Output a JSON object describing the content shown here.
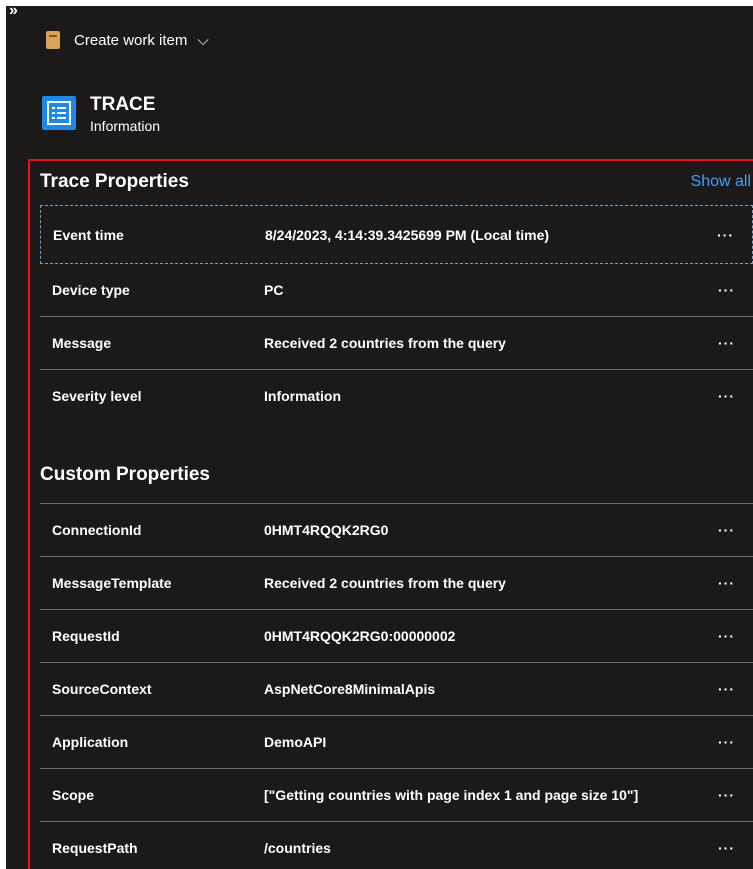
{
  "toolbar": {
    "create_label": "Create work item",
    "chevron": "⌵"
  },
  "header": {
    "title": "TRACE",
    "subtitle": "Information"
  },
  "trace": {
    "title": "Trace Properties",
    "show_all": "Show all",
    "rows": [
      {
        "name": "Event time",
        "value": "8/24/2023, 4:14:39.3425699 PM (Local time)"
      },
      {
        "name": "Device type",
        "value": "PC"
      },
      {
        "name": "Message",
        "value": "Received 2 countries from the query"
      },
      {
        "name": "Severity level",
        "value": "Information"
      }
    ]
  },
  "custom": {
    "title": "Custom Properties",
    "rows": [
      {
        "name": "ConnectionId",
        "value": "0HMT4RQQK2RG0"
      },
      {
        "name": "MessageTemplate",
        "value": "Received 2 countries from the query"
      },
      {
        "name": "RequestId",
        "value": "0HMT4RQQK2RG0:00000002"
      },
      {
        "name": "SourceContext",
        "value": "AspNetCore8MinimalApis"
      },
      {
        "name": "Application",
        "value": "DemoAPI"
      },
      {
        "name": "Scope",
        "value": "[\"Getting countries with page index 1 and page size 10\"]"
      },
      {
        "name": "RequestPath",
        "value": "/countries"
      }
    ]
  },
  "more_glyph": "···",
  "icons": {
    "expand": "expand-icon",
    "work_item": "work-item-icon",
    "trace": "trace-list-icon"
  },
  "colors": {
    "background": "#1b1a19",
    "link": "#479ef5",
    "highlight": "#e81123",
    "trace_icon": "#1e88e5"
  }
}
